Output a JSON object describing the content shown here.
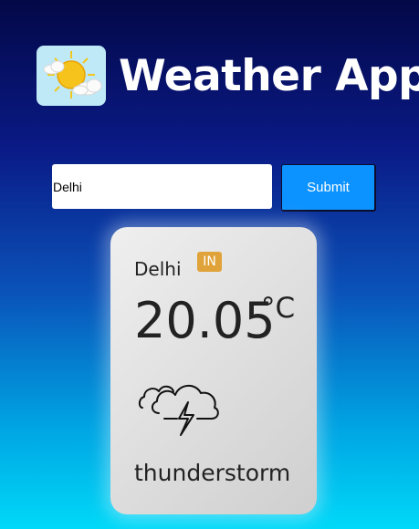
{
  "header": {
    "title": "Weather App",
    "logo_icon": "sun-cloud-icon"
  },
  "search": {
    "value": "Delhi",
    "submit_label": "Submit"
  },
  "card": {
    "city": "Delhi",
    "country": "IN",
    "temperature": "20.05",
    "unit": "°C",
    "condition_icon": "thunderstorm-icon",
    "description": "thunderstorm"
  }
}
